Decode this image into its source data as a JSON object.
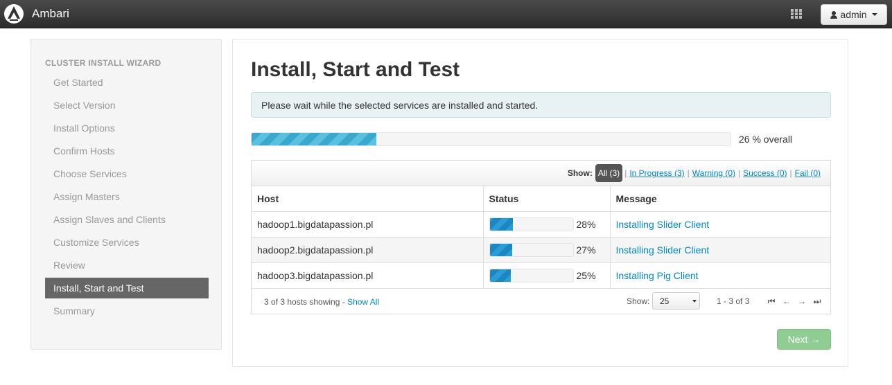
{
  "app": {
    "brand": "Ambari",
    "user_label": "admin"
  },
  "sidebar": {
    "title": "CLUSTER INSTALL WIZARD",
    "items": [
      {
        "label": "Get Started"
      },
      {
        "label": "Select Version"
      },
      {
        "label": "Install Options"
      },
      {
        "label": "Confirm Hosts"
      },
      {
        "label": "Choose Services"
      },
      {
        "label": "Assign Masters"
      },
      {
        "label": "Assign Slaves and Clients"
      },
      {
        "label": "Customize Services"
      },
      {
        "label": "Review"
      },
      {
        "label": "Install, Start and Test",
        "active": true
      },
      {
        "label": "Summary"
      }
    ]
  },
  "main": {
    "title": "Install, Start and Test",
    "notice": "Please wait while the selected services are installed and started.",
    "overall_progress": 26,
    "overall_text": "26 % overall",
    "filters": {
      "label": "Show:",
      "all": "All (3)",
      "in_progress": "In Progress (3)",
      "warning": "Warning (0)",
      "success": "Success (0)",
      "fail": "Fail (0)"
    },
    "table": {
      "headers": {
        "host": "Host",
        "status": "Status",
        "message": "Message"
      },
      "rows": [
        {
          "host": "hadoop1.bigdatapassion.pl",
          "progress": 28,
          "pct": "28%",
          "message": "Installing Slider Client"
        },
        {
          "host": "hadoop2.bigdatapassion.pl",
          "progress": 27,
          "pct": "27%",
          "message": "Installing Slider Client"
        },
        {
          "host": "hadoop3.bigdatapassion.pl",
          "progress": 25,
          "pct": "25%",
          "message": "Installing Pig Client"
        }
      ]
    },
    "footer": {
      "count_text": "3 of 3 hosts showing - ",
      "show_all": "Show All",
      "show_label": "Show:",
      "page_size": "25",
      "page_info": "1 - 3 of 3"
    },
    "next_label": "Next →"
  }
}
